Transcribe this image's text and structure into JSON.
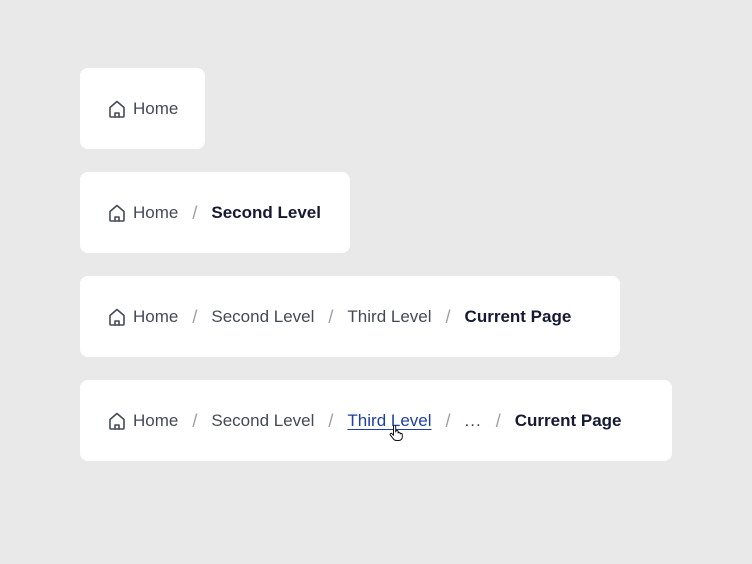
{
  "breadcrumbs": {
    "one": {
      "home": "Home"
    },
    "two": {
      "home": "Home",
      "sep": "/",
      "current": "Second Level"
    },
    "three": {
      "home": "Home",
      "sep": "/",
      "second": "Second Level",
      "third": "Third Level",
      "current": "Current Page"
    },
    "four": {
      "home": "Home",
      "sep": "/",
      "second": "Second Level",
      "third": "Third Level",
      "ellipsis": "...",
      "current": "Current Page"
    }
  },
  "icons": {
    "home": "home-icon",
    "cursor": "hand-pointer-icon"
  },
  "colors": {
    "background": "#e9e9e9",
    "card": "#ffffff",
    "link": "#1d3fa3",
    "current": "#141a33",
    "text": "#434a57",
    "separator": "#9aa0a8"
  }
}
